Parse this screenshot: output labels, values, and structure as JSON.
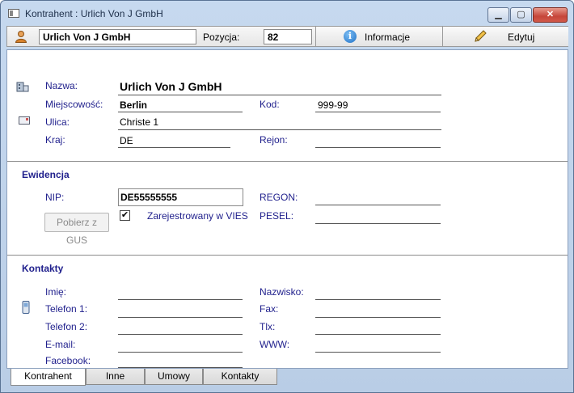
{
  "window": {
    "title": "Kontrahent : Urlich Von J GmbH",
    "min_symbol": "▁",
    "max_symbol": "▢",
    "close_symbol": "✕"
  },
  "toolbar": {
    "name_value": "Urlich Von J GmbH",
    "position_label": "Pozycja:",
    "position_value": "82",
    "info_label": "Informacje",
    "edit_label": "Edytuj"
  },
  "address": {
    "name_label": "Nazwa:",
    "name_value": "Urlich Von J GmbH",
    "city_label": "Miejscowość:",
    "city_value": "Berlin",
    "code_label": "Kod:",
    "code_value": "999-99",
    "street_label": "Ulica:",
    "street_value": "Christe 1",
    "country_label": "Kraj:",
    "country_value": "DE",
    "region_label": "Rejon:",
    "region_value": ""
  },
  "ewidencja": {
    "section_title": "Ewidencja",
    "nip_label": "NIP:",
    "nip_value": "DE55555555",
    "regon_label": "REGON:",
    "regon_value": "",
    "gus_button": "Pobierz z GUS",
    "vies_label": "Zarejestrowany w VIES",
    "vies_checked": "✔",
    "pesel_label": "PESEL:",
    "pesel_value": ""
  },
  "kontakty": {
    "section_title": "Kontakty",
    "imie_label": "Imię:",
    "nazwisko_label": "Nazwisko:",
    "tel1_label": "Telefon 1:",
    "fax_label": "Fax:",
    "tel2_label": "Telefon 2:",
    "tlx_label": "Tlx:",
    "email_label": "E-mail:",
    "www_label": "WWW:",
    "facebook_label": "Facebook:"
  },
  "tabs": [
    "Kontrahent",
    "Inne",
    "Umowy",
    "Kontakty"
  ],
  "icons": {
    "app": "window-app-icon",
    "person": "person-icon",
    "info": "info-icon",
    "edit": "pencil-icon",
    "building": "building-icon",
    "envelope": "envelope-icon",
    "phone": "phone-icon"
  },
  "colors": {
    "label_blue": "#1f1f8c",
    "title_bar": "#c6d9ef",
    "close_red": "#c6463a"
  }
}
